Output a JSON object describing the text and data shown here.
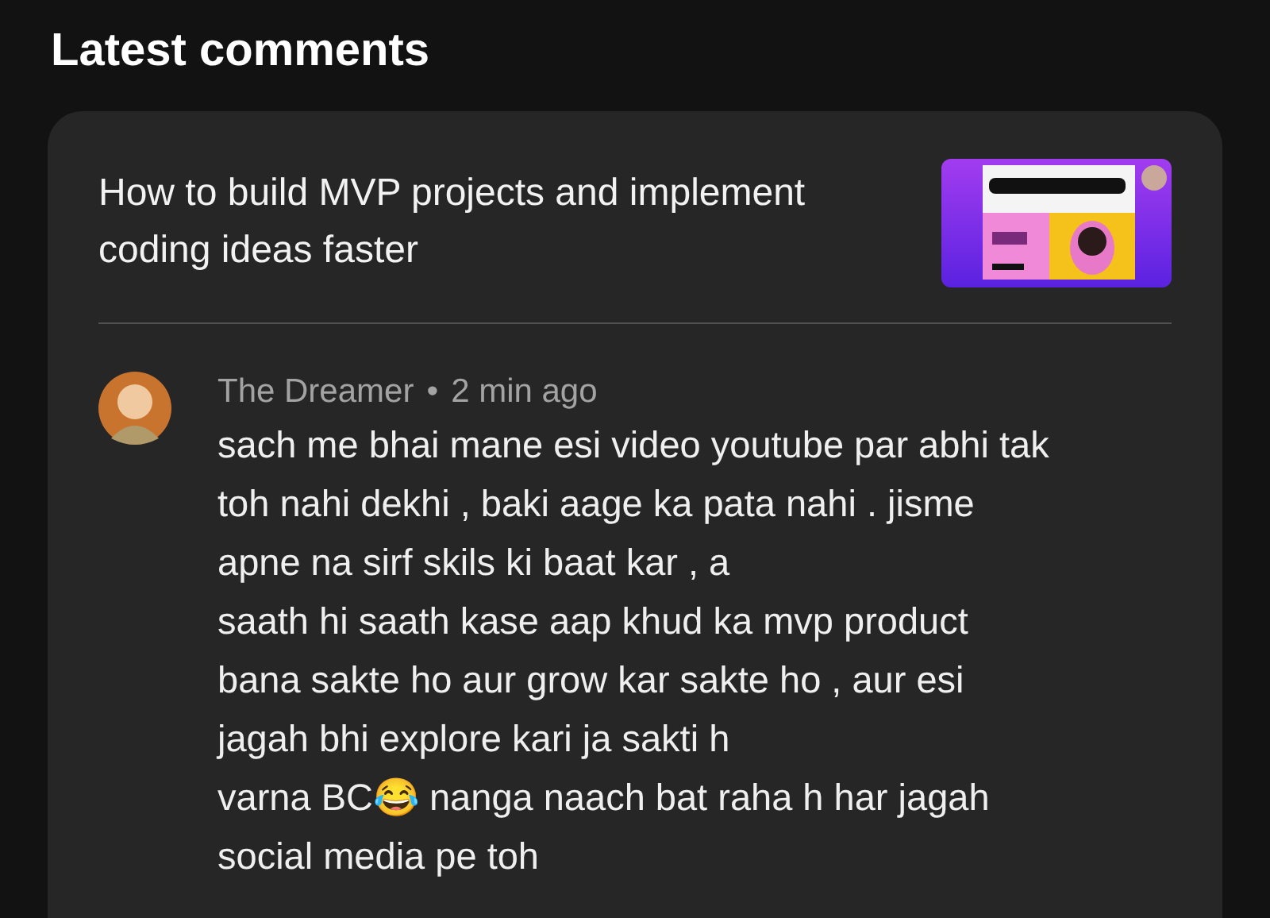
{
  "heading": "Latest comments",
  "video": {
    "title": "How to build MVP projects and implement coding ideas faster"
  },
  "comments": [
    {
      "author": "The Dreamer",
      "separator": "•",
      "time": "2 min ago",
      "text": "sach me bhai mane esi video youtube par abhi tak\ntoh nahi dekhi , baki aage ka pata nahi . jisme\napne na sirf skils ki baat kar , a\nsaath hi saath kase aap khud ka mvp product\nbana sakte ho aur grow kar sakte ho , aur esi\njagah bhi explore kari ja sakti h\nvarna BC😂 nanga naach bat raha h har jagah\nsocial media pe toh"
    }
  ]
}
